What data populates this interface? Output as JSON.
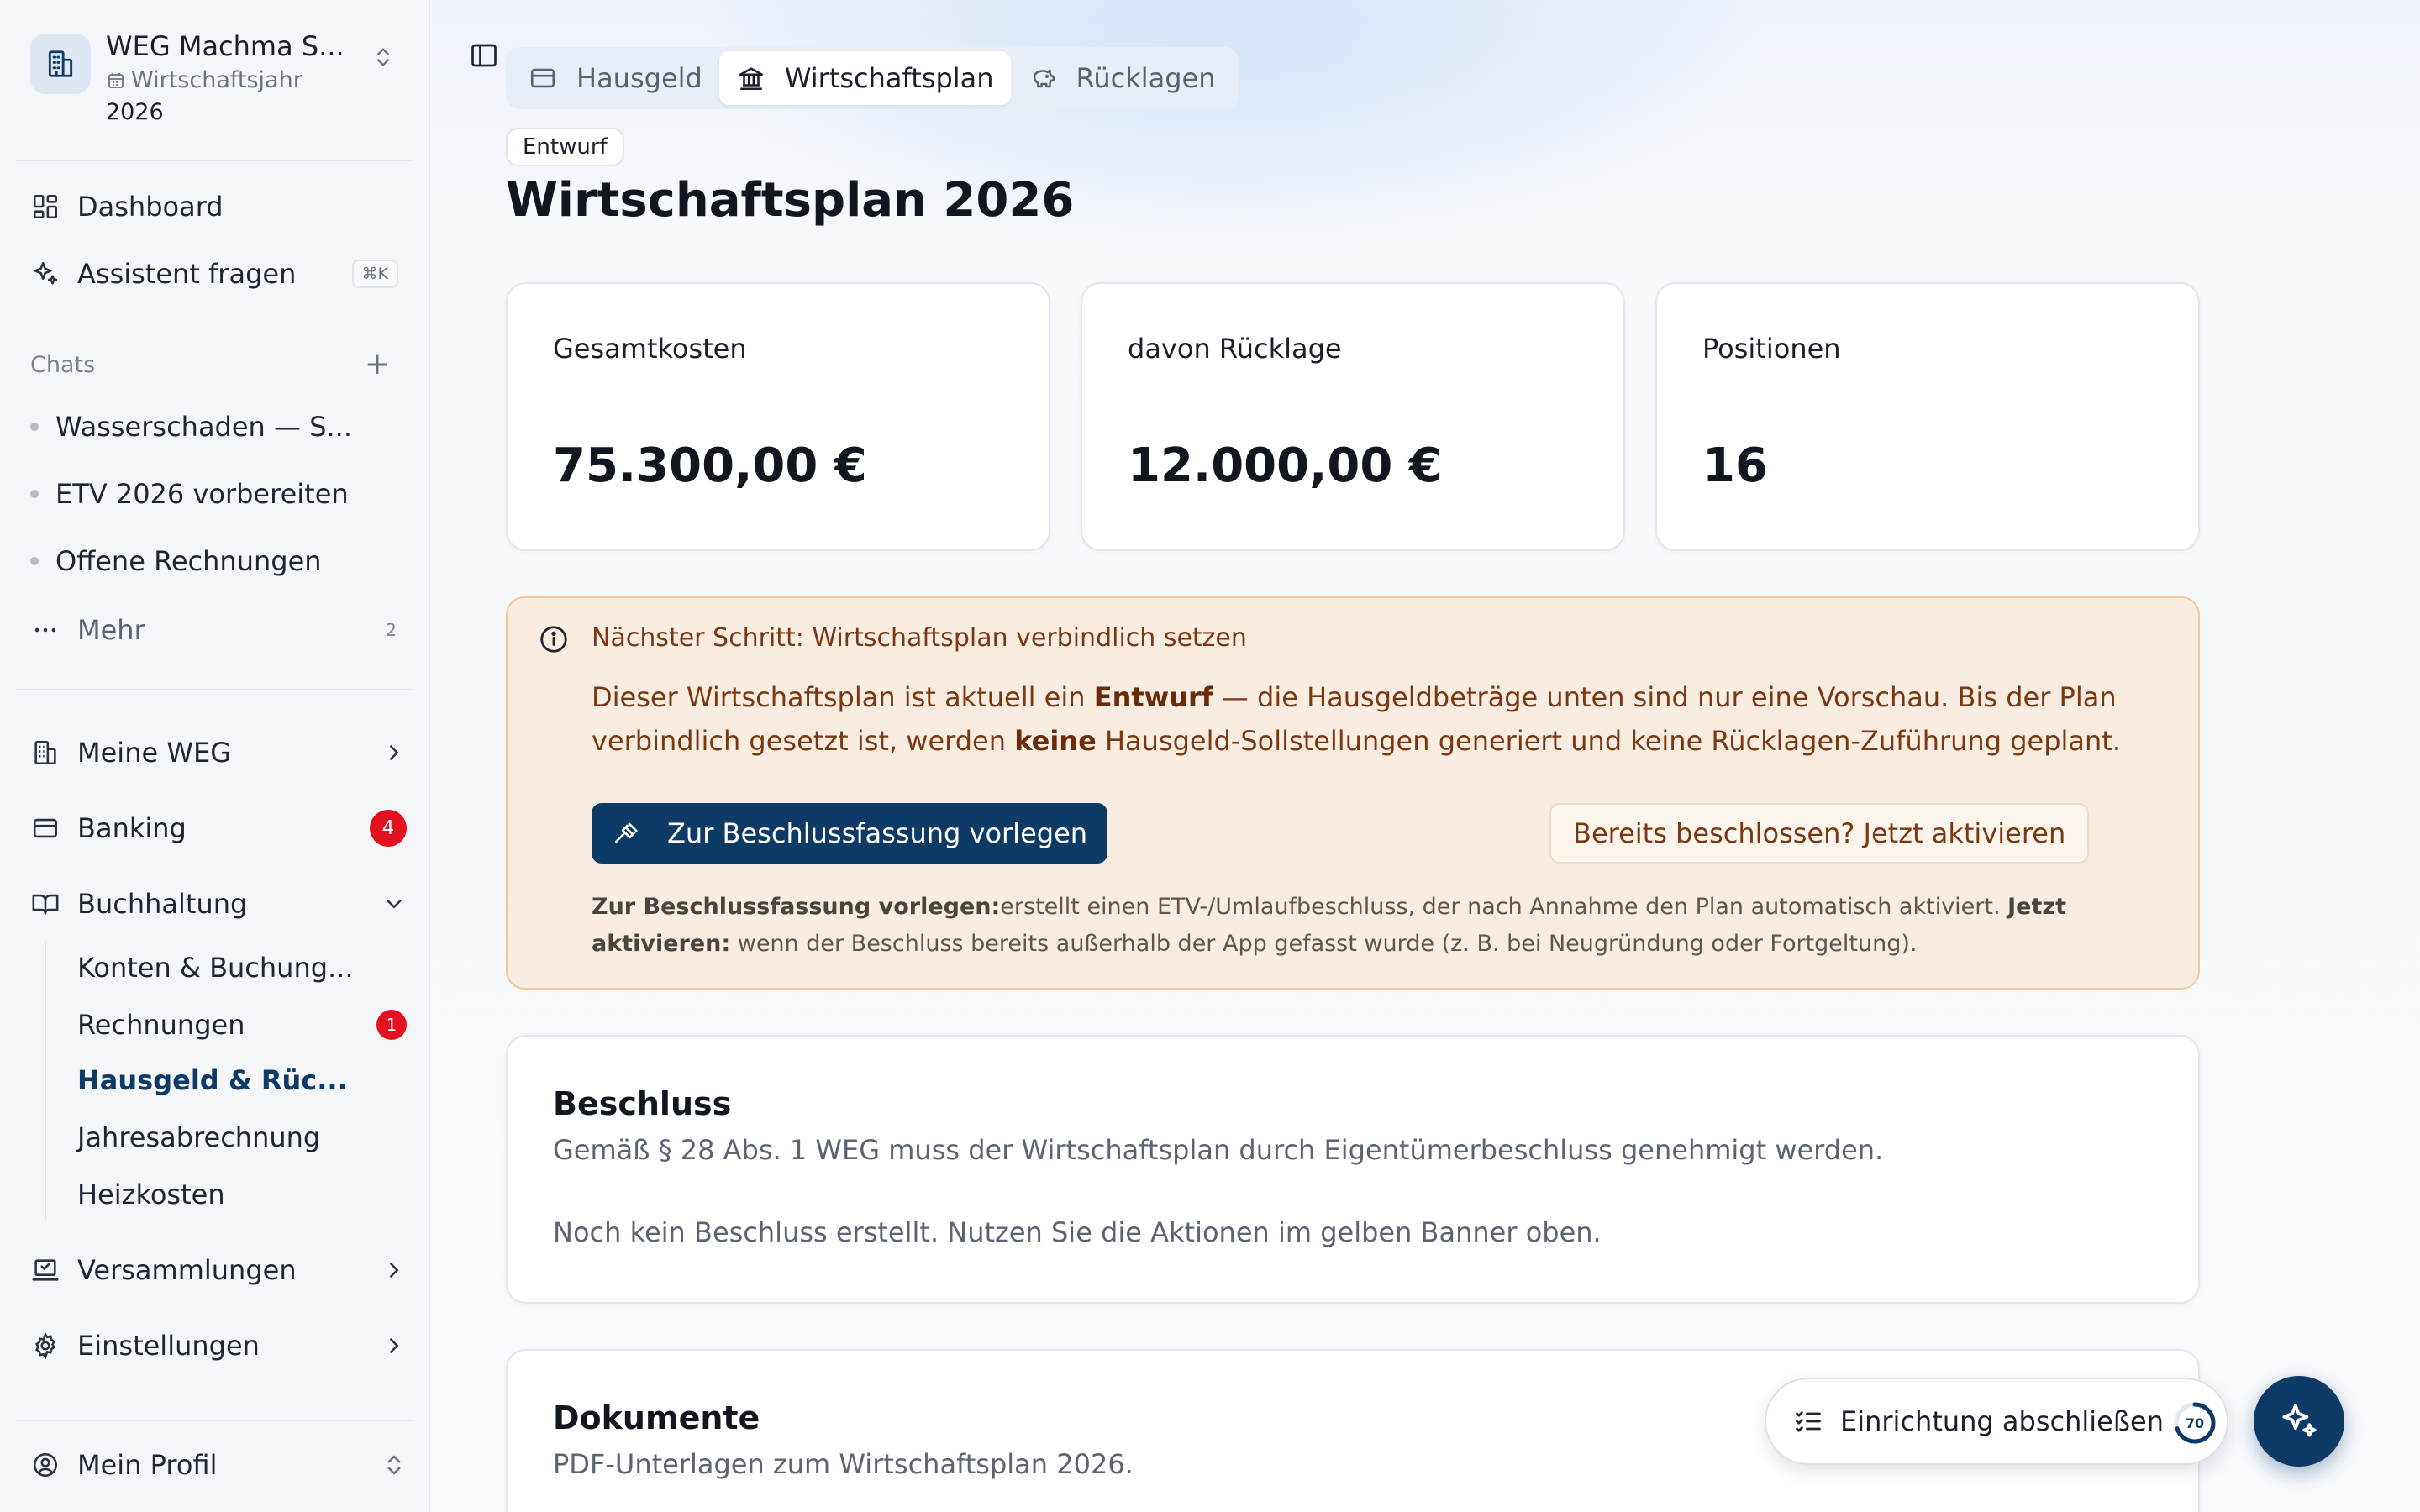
{
  "workspace": {
    "name": "WEG Machma S...",
    "year_label": "Wirtschaftsjahr",
    "year": "2026"
  },
  "sidebar": {
    "top": [
      {
        "label": "Dashboard"
      },
      {
        "label": "Assistent fragen",
        "shortcut": "⌘K"
      }
    ],
    "chats_label": "Chats",
    "chats": [
      "Wasserschaden — S...",
      "ETV 2026 vorbereiten",
      "Offene Rechnungen"
    ],
    "more": {
      "label": "Mehr",
      "count": "2"
    },
    "sections": [
      {
        "label": "Meine WEG"
      },
      {
        "label": "Banking",
        "badge": "4"
      },
      {
        "label": "Buchhaltung"
      }
    ],
    "sub_items": [
      {
        "label": "Konten & Buchung..."
      },
      {
        "label": "Rechnungen",
        "badge": "1"
      },
      {
        "label": "Hausgeld & Rüc..."
      },
      {
        "label": "Jahresabrechnung"
      },
      {
        "label": "Heizkosten"
      }
    ],
    "bottom_sections": [
      {
        "label": "Versammlungen"
      },
      {
        "label": "Einstellungen"
      }
    ],
    "profile": "Mein Profil"
  },
  "tabs": [
    "Hausgeld",
    "Wirtschaftsplan",
    "Rücklagen"
  ],
  "status": "Entwurf",
  "title": "Wirtschaftsplan 2026",
  "stats": [
    {
      "label": "Gesamtkosten",
      "value": "75.300,00 €"
    },
    {
      "label": "davon Rücklage",
      "value": "12.000,00 €"
    },
    {
      "label": "Positionen",
      "value": "16"
    }
  ],
  "banner": {
    "title": "Nächster Schritt: Wirtschaftsplan verbindlich setzen",
    "text": {
      "p1": "Dieser Wirtschaftsplan ist aktuell ein ",
      "b1": "Entwurf",
      "p2": " — die Hausgeldbeträge unten sind nur eine Vorschau. Bis der Plan verbindlich gesetzt ist, werden ",
      "b2": "keine",
      "p3": " Hausgeld-Sollstellungen generiert und keine Rücklagen-Zuführung geplant."
    },
    "primary_button": "Zur Beschlussfassung vorlegen",
    "secondary_button": "Bereits beschlossen? Jetzt aktivieren",
    "note": {
      "b1": "Zur Beschlussfassung vorlegen:",
      "t1": "erstellt einen ETV-/Umlaufbeschluss, der nach Annahme den Plan automatisch aktiviert.  ",
      "b2": "Jetzt aktivieren:",
      "t2": " wenn der Beschluss bereits außerhalb der App gefasst wurde (z. B. bei Neugründung oder Fortgeltung)."
    }
  },
  "beschluss": {
    "title": "Beschluss",
    "text1": "Gemäß § 28 Abs. 1 WEG muss der Wirtschaftsplan durch Eigentümerbeschluss genehmigt werden.",
    "text2": "Noch kein Beschluss erstellt. Nutzen Sie die Aktionen im gelben Banner oben."
  },
  "dokumente": {
    "title": "Dokumente",
    "text": "PDF-Unterlagen zum Wirtschaftsplan 2026."
  },
  "setup": {
    "label": "Einrichtung abschließen",
    "progress": "70"
  },
  "colors": {
    "accent": "#0e3a66",
    "badge": "#e3101f",
    "banner_bg": "#f8ede0",
    "banner_text": "#7a3812"
  }
}
